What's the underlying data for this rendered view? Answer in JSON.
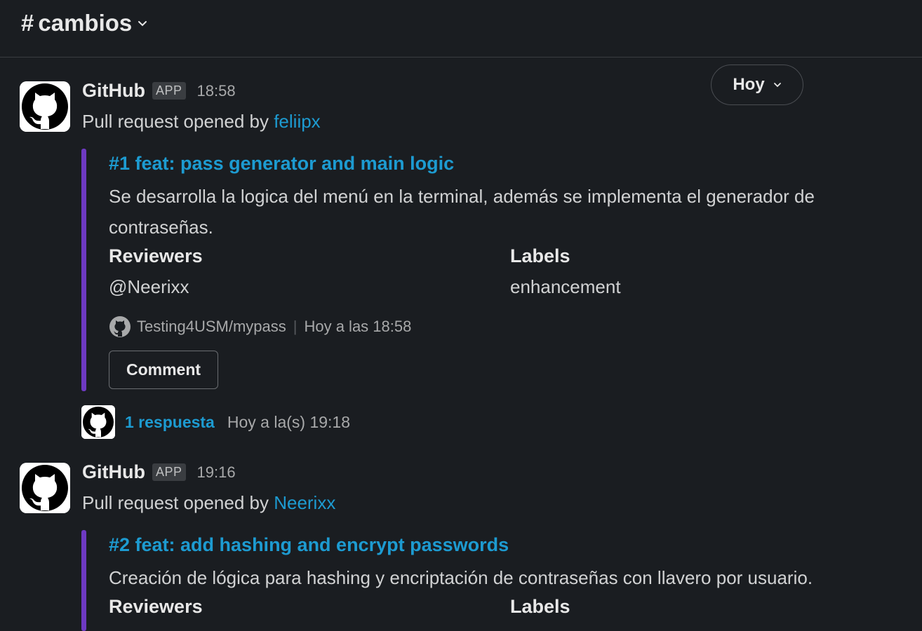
{
  "header": {
    "channel_hash": "#",
    "channel_name": "cambios"
  },
  "date_pill": {
    "label": "Hoy"
  },
  "messages": [
    {
      "sender": "GitHub",
      "badge": "APP",
      "time": "18:58",
      "intro": "Pull request opened by ",
      "author": "feliipx",
      "pr_title": "#1 feat: pass generator and main logic",
      "pr_body": "Se desarrolla la logica del menú en la terminal, además se implementa el generador de contraseñas.",
      "reviewers_label": "Reviewers",
      "reviewers_value": "@Neerixx",
      "labels_label": "Labels",
      "labels_value": "enhancement",
      "repo": "Testing4USM/mypass",
      "repo_time": "Hoy a las 18:58",
      "comment_button": "Comment",
      "thread_count": "1 respuesta",
      "thread_time": "Hoy a la(s) 19:18"
    },
    {
      "sender": "GitHub",
      "badge": "APP",
      "time": "19:16",
      "intro": "Pull request opened by ",
      "author": "Neerixx",
      "pr_title": "#2 feat: add hashing and encrypt passwords",
      "pr_body": "Creación de lógica para hashing y encriptación de contraseñas con llavero por usuario.",
      "reviewers_label": "Reviewers",
      "labels_label": "Labels"
    }
  ],
  "colors": {
    "background": "#1a1d21",
    "link": "#1d9bd1",
    "attachment_bar": "#6e3ac2"
  },
  "icons": {
    "avatar": "github-octocat-icon",
    "chevron": "chevron-down-icon"
  }
}
